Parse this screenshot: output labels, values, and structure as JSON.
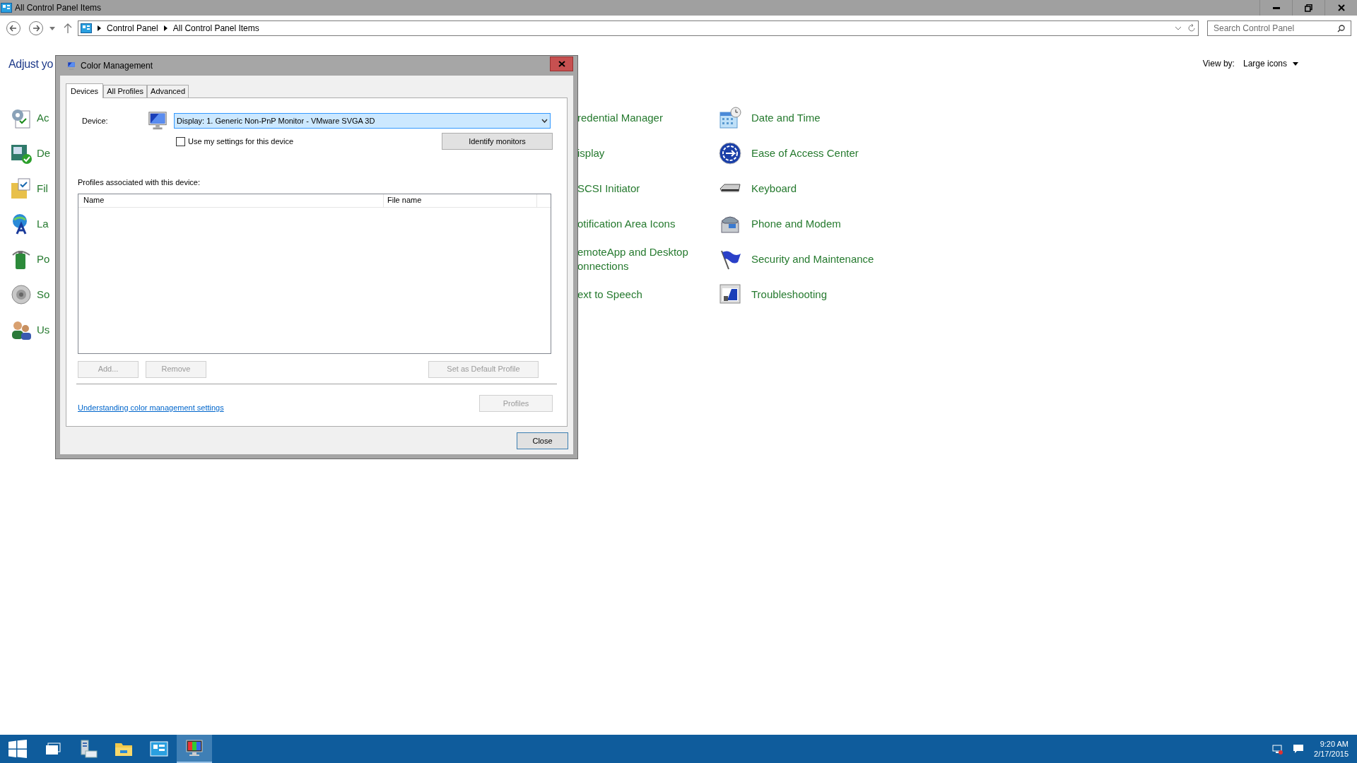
{
  "window": {
    "title": "All Control Panel Items"
  },
  "address_bar": {
    "breadcrumbs": [
      "Control Panel",
      "All Control Panel Items"
    ]
  },
  "search": {
    "placeholder": "Search Control Panel"
  },
  "header": {
    "title": "Adjust yo",
    "view_by_label": "View by:",
    "view_by_value": "Large icons"
  },
  "left_items": [
    "Ac",
    "De",
    "Fil",
    "La",
    "Po",
    "So",
    "Us"
  ],
  "middle_items": [
    "redential Manager",
    "isplay",
    "SCSI Initiator",
    "otification Area Icons",
    "emoteApp and Desktop onnections",
    "ext to Speech"
  ],
  "right_items": [
    "Date and Time",
    "Ease of Access Center",
    "Keyboard",
    "Phone and Modem",
    "Security and Maintenance",
    "Troubleshooting"
  ],
  "dialog": {
    "title": "Color Management",
    "tabs": [
      {
        "label": "Devices",
        "selected": true
      },
      {
        "label": "All Profiles",
        "selected": false
      },
      {
        "label": "Advanced",
        "selected": false
      }
    ],
    "device_label": "Device:",
    "device_value": "Display: 1. Generic Non-PnP Monitor - VMware SVGA 3D",
    "use_settings": {
      "label": "Use my settings for this device",
      "checked": false
    },
    "identify_button": "Identify monitors",
    "profiles_label": "Profiles associated with this device:",
    "columns": [
      "Name",
      "File name"
    ],
    "buttons": [
      {
        "label": "Add...",
        "disabled": true
      },
      {
        "label": "Remove",
        "disabled": true
      },
      {
        "label": "Set as Default Profile",
        "disabled": true
      }
    ],
    "link": "Understanding color management settings",
    "profiles_button": {
      "label": "Profiles",
      "disabled": true
    },
    "close_button": "Close"
  },
  "taskbar": {
    "apps": [
      {
        "kind": "start",
        "selected": false
      },
      {
        "kind": "task-view",
        "selected": false
      },
      {
        "kind": "server-manager",
        "selected": false
      },
      {
        "kind": "explorer",
        "selected": false
      },
      {
        "kind": "control-panel",
        "selected": false
      },
      {
        "kind": "color-management",
        "selected": true
      }
    ],
    "time": "9:20 AM",
    "date": "2/17/2015"
  }
}
